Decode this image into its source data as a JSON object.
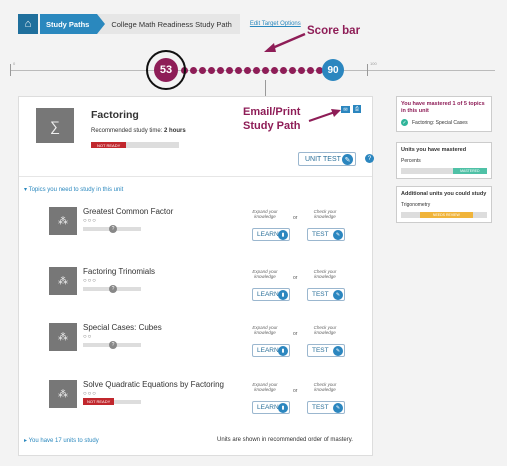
{
  "breadcrumb": {
    "path_label": "Study Paths",
    "current": "College Math Readiness Study Path",
    "edit_link": "Edit Target Options"
  },
  "scorebar": {
    "start_score": "53",
    "end_score": "90",
    "tick_start": "0",
    "tick_end": "100"
  },
  "annotations": {
    "score_bar": "Score bar",
    "email_print_line1": "Email/Print",
    "email_print_line2": "Study Path"
  },
  "unit": {
    "title": "Factoring",
    "study_time_prefix": "Recommended study time: ",
    "study_time_value": "2 hours",
    "status": "NOT READY",
    "unit_test_label": "UNIT TEST"
  },
  "topics_header": "Topics you need to study in this unit",
  "topics": [
    {
      "title": "Greatest Common Factor",
      "circles": "○○○",
      "status": ""
    },
    {
      "title": "Factoring Trinomials",
      "circles": "○○○",
      "status": ""
    },
    {
      "title": "Special Cases: Cubes",
      "circles": "○○",
      "status": ""
    },
    {
      "title": "Solve Quadratic Equations by Factoring",
      "circles": "○○○",
      "status": "NOT READY"
    }
  ],
  "topic_actions": {
    "expand_caption": "Expand your knowledge",
    "or": "or",
    "check_caption": "Check your knowledge",
    "learn_label": "LEARN",
    "test_label": "TEST"
  },
  "footer": {
    "units_to_study": "You have 17 units to study",
    "order_note": "Units are shown in recommended order of mastery."
  },
  "mastered_panel": {
    "title": "You have mastered 1 of 5 topics in this unit",
    "item": "Factoring: Special Cases"
  },
  "units_mastered_panel": {
    "title": "Units you have mastered",
    "item": "Percents",
    "badge": "MASTERED"
  },
  "additional_panel": {
    "title": "Additional units you could study",
    "item": "Trigonometry",
    "badge": "NEEDS REVIEW"
  },
  "colors": {
    "brand_blue": "#2b86bf",
    "score_maroon": "#8e1d57",
    "not_ready_red": "#c1272d",
    "mastered_teal": "#4fc1a6",
    "needs_review_yellow": "#f0b43a"
  }
}
